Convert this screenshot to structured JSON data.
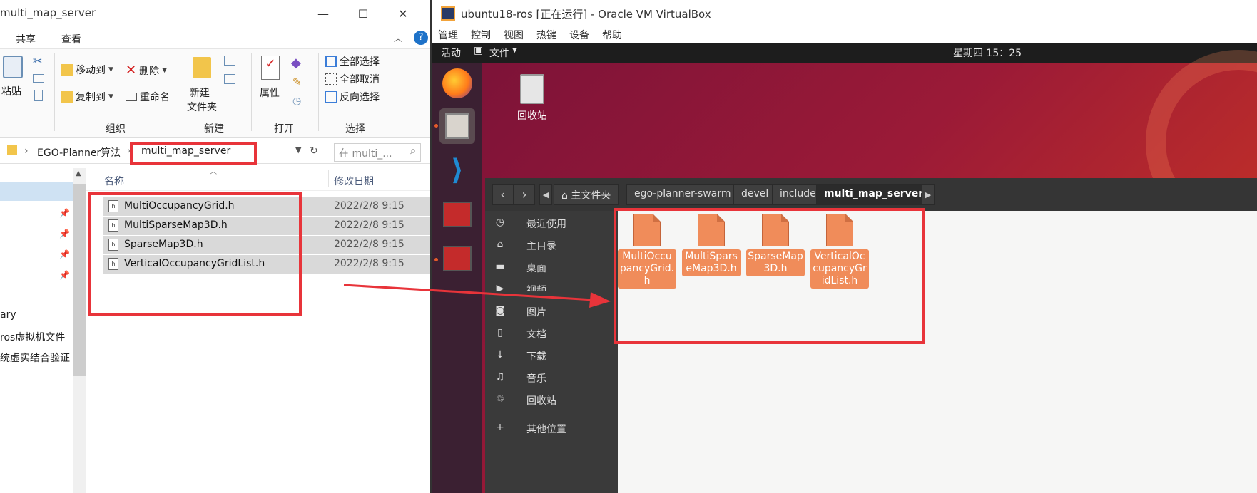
{
  "explorer": {
    "window_title": "multi_map_server",
    "controls": {
      "minimize": "—",
      "maximize": "☐",
      "close": "✕"
    },
    "tabs": [
      "共享",
      "查看"
    ],
    "ribbon": {
      "paste": "粘贴",
      "move_to": "移动到",
      "copy_to": "复制到",
      "delete": "删除",
      "rename": "重命名",
      "new_folder_1": "新建",
      "new_folder_2": "文件夹",
      "properties": "属性",
      "select_all": "全部选择",
      "select_none": "全部取消",
      "invert_select": "反向选择",
      "groups": {
        "organize": "组织",
        "new": "新建",
        "open": "打开",
        "select": "选择"
      }
    },
    "address": {
      "crumb1": "EGO-Planner算法",
      "crumb2": "multi_map_server"
    },
    "search_placeholder": "在 multi_...",
    "nav_items": [
      "ary",
      "ros虚拟机文件",
      "统虚实结合验证"
    ],
    "columns": {
      "name": "名称",
      "date": "修改日期"
    },
    "files": [
      {
        "name": "MultiOccupancyGrid.h",
        "date": "2022/2/8 9:15"
      },
      {
        "name": "MultiSparseMap3D.h",
        "date": "2022/2/8 9:15"
      },
      {
        "name": "SparseMap3D.h",
        "date": "2022/2/8 9:15"
      },
      {
        "name": "VerticalOccupancyGridList.h",
        "date": "2022/2/8 9:15"
      }
    ]
  },
  "virtualbox": {
    "window_title": "ubuntu18-ros [正在运行] - Oracle VM VirtualBox",
    "menu": [
      "管理",
      "控制",
      "视图",
      "热键",
      "设备",
      "帮助"
    ],
    "topbar": {
      "activities": "活动",
      "files_menu": "文件",
      "clock": "星期四 15：25"
    },
    "desktop_trash": "回收站",
    "path": [
      "主文件夹",
      "ego-planner-swarm",
      "devel",
      "include",
      "multi_map_server"
    ],
    "sidebar": [
      "最近使用",
      "主目录",
      "桌面",
      "视频",
      "图片",
      "文档",
      "下载",
      "音乐",
      "回收站",
      "其他位置"
    ],
    "icons": [
      {
        "label": "MultiOccupancyGrid.h"
      },
      {
        "label": "MultiSparseMap3D.h"
      },
      {
        "label": "SparseMap3D.h"
      },
      {
        "label": "VerticalOccupancyGridList.h"
      }
    ],
    "colors": {
      "highlight": "#e8343a",
      "file_icon": "#f08c5a",
      "desktop": "#9b1a37"
    }
  }
}
